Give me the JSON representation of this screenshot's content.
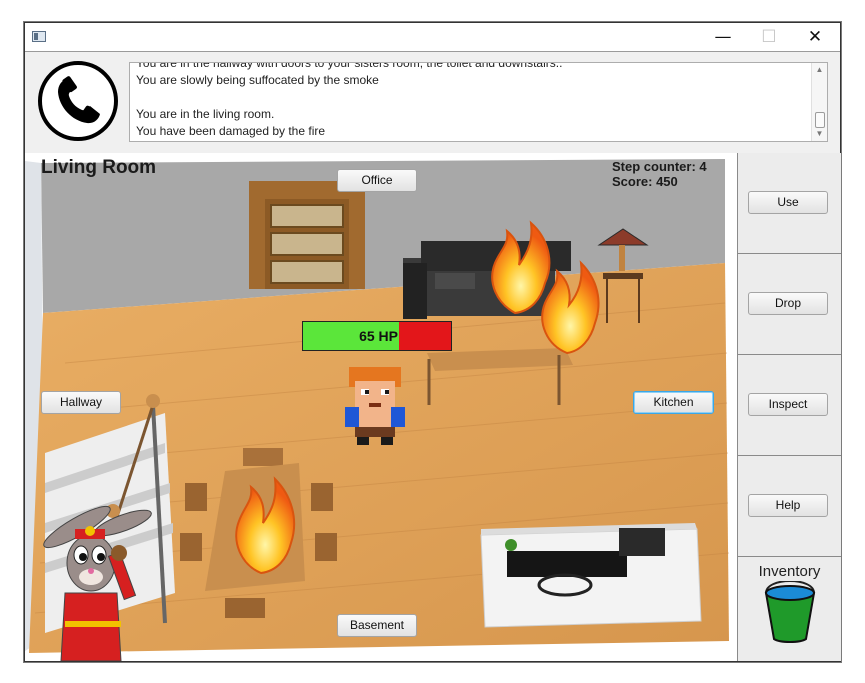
{
  "window": {
    "controls": {
      "minimize": "—",
      "maximize": "☐",
      "close": "✕"
    }
  },
  "log": {
    "lines": [
      "You are in the hallway with doors to your sisters room, the toilet and downstairs..",
      "You are slowly being suffocated by the smoke",
      "",
      "You are in the living room.",
      "You have been damaged by the fire"
    ]
  },
  "room": {
    "title": "Living Room",
    "step_counter_label": "Step counter: 4",
    "score_label": "Score: 450"
  },
  "player": {
    "hp_label": "65 HP",
    "hp_fraction": 0.65
  },
  "doors": {
    "office": "Office",
    "hallway": "Hallway",
    "kitchen": "Kitchen",
    "basement": "Basement"
  },
  "actions": {
    "use": "Use",
    "drop": "Drop",
    "inspect": "Inspect",
    "help": "Help"
  },
  "inventory": {
    "label": "Inventory",
    "items": [
      "bucket-icon"
    ]
  },
  "colors": {
    "hp_green": "#5be63a",
    "hp_red": "#e3161a",
    "bucket_green": "#1f9a2a",
    "floor": "#e3a45b"
  }
}
